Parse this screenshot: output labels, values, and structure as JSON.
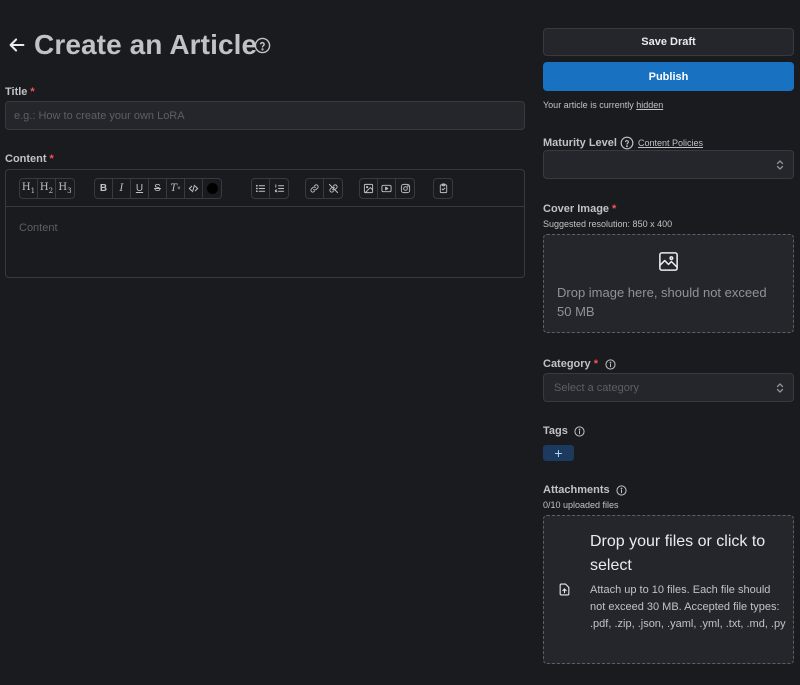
{
  "header": {
    "title": "Create an Article"
  },
  "form": {
    "title_label": "Title",
    "title_placeholder": "e.g.: How to create your own LoRA",
    "required_mark": "*",
    "content_label": "Content",
    "content_placeholder": "Content",
    "toolbar": {
      "h1": "H",
      "h1_sub": "1",
      "h2": "H",
      "h2_sub": "2",
      "h3": "H",
      "h3_sub": "3",
      "bold": "B",
      "italic": "I",
      "underline": "U",
      "strike": "S",
      "clear": "T"
    }
  },
  "sidebar": {
    "save_label": "Save Draft",
    "publish_label": "Publish",
    "visibility_prefix": "Your article is currently",
    "visibility_value": "hidden",
    "maturity_label": "Maturity Level",
    "content_policies_link": "Content Policies",
    "maturity_value": "",
    "cover_label": "Cover Image",
    "cover_hint": "Suggested resolution: 850 x 400",
    "cover_drop_text": "Drop image here, should not exceed 50 MB",
    "category_label": "Category",
    "category_placeholder": "Select a category",
    "tags_label": "Tags",
    "add_tag": "+",
    "attachments_label": "Attachments",
    "attachments_count": "0/10 uploaded files",
    "attachments_title": "Drop your files or click to select",
    "attachments_desc": "Attach up to 10 files. Each file should not exceed 30 MB. Accepted file types: .pdf, .zip, .json, .yaml, .yml, .txt, .md, .py"
  },
  "colors": {
    "background": "#1a1b1e",
    "accent": "#1971c2",
    "required": "#fa5252"
  }
}
